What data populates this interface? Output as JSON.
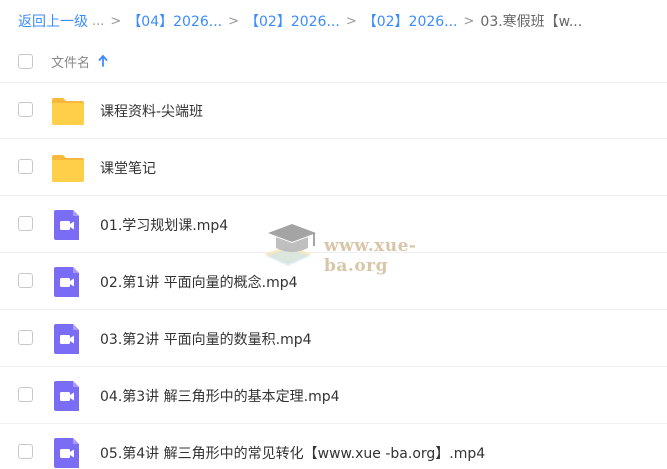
{
  "breadcrumb": {
    "back": "返回上一级",
    "ellipsis": "...",
    "separator": ">",
    "items": [
      "【04】2026...",
      "【02】2026...",
      "【02】2026..."
    ],
    "current": "03.寒假班【w..."
  },
  "header": {
    "column_label": "文件名",
    "sort_icon": "arrow-up-icon"
  },
  "files": [
    {
      "name": "课程资料-尖端班",
      "type": "folder",
      "icon": "folder-icon"
    },
    {
      "name": "课堂笔记",
      "type": "folder",
      "icon": "folder-icon"
    },
    {
      "name": "01.学习规划课.mp4",
      "type": "video",
      "icon": "video-file-icon"
    },
    {
      "name": "02.第1讲 平面向量的概念.mp4",
      "type": "video",
      "icon": "video-file-icon"
    },
    {
      "name": "03.第2讲 平面向量的数量积.mp4",
      "type": "video",
      "icon": "video-file-icon"
    },
    {
      "name": "04.第3讲 解三角形中的基本定理.mp4",
      "type": "video",
      "icon": "video-file-icon"
    },
    {
      "name": "05.第4讲 解三角形中的常见转化【www.xue -ba.org】.mp4",
      "type": "video",
      "icon": "video-file-icon"
    }
  ],
  "watermark": {
    "text": "www.xue-ba.org",
    "icon": "graduation-cap-icon"
  },
  "colors": {
    "link": "#3b8cff",
    "folder": "#ffcf4a",
    "video": "#7b6cf6"
  }
}
